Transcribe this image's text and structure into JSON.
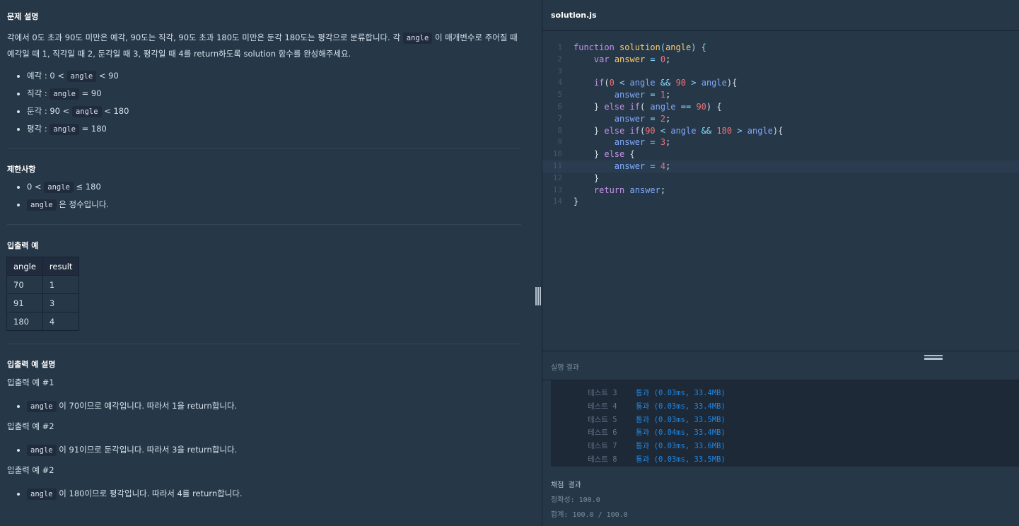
{
  "problem": {
    "title": "문제 설명",
    "desc_part1": "각에서 0도 초과 90도 미만은 예각, 90도는 직각, 90도 초과 180도 미만은 둔각 180도는 평각으로 분류합니다. 각",
    "desc_code": "angle",
    "desc_part2": "이 매개변수로 주어질 때",
    "desc_line2": "예각일 때 1, 직각일 때 2, 둔각일 때 3, 평각일 때 4를 return하도록 solution 함수를 완성해주세요.",
    "bullets": [
      {
        "label": "예각 : 0 <",
        "code": "angle",
        "after": "< 90"
      },
      {
        "label": "직각 :",
        "code": "angle",
        "after": "= 90"
      },
      {
        "label": "둔각 : 90 <",
        "code": "angle",
        "after": "< 180"
      },
      {
        "label": "평각 :",
        "code": "angle",
        "after": "= 180"
      }
    ]
  },
  "constraints": {
    "title": "제한사항",
    "item1_pre": "0 <",
    "item1_code": "angle",
    "item1_post": "≤ 180",
    "item2_code": "angle",
    "item2_post": "은 정수입니다."
  },
  "io_example": {
    "title": "입출력 예",
    "headers": [
      "angle",
      "result"
    ],
    "rows": [
      [
        "70",
        "1"
      ],
      [
        "91",
        "3"
      ],
      [
        "180",
        "4"
      ]
    ]
  },
  "io_explain": {
    "title": "입출력 예 설명",
    "ex1_title": "입출력 예 #1",
    "ex1_code": "angle",
    "ex1_text": "이 70이므로 예각입니다. 따라서 1을 return합니다.",
    "ex2_title": "입출력 예 #2",
    "ex2_code": "angle",
    "ex2_text": "이 91이므로 둔각입니다. 따라서 3을 return합니다.",
    "ex3_title": "입출력 예 #2",
    "ex3_code": "angle",
    "ex3_text": "이 180이므로 평각입니다. 따라서 4를 return합니다."
  },
  "editor": {
    "filename": "solution.js",
    "line_numbers": [
      "1",
      "2",
      "3",
      "4",
      "5",
      "6",
      "7",
      "8",
      "9",
      "10",
      "11",
      "12",
      "13",
      "14"
    ],
    "active_line": 11
  },
  "results_panel": {
    "title": "실행 결과",
    "rows": [
      {
        "label": "테스트 3",
        "value": "통과 (0.03ms, 33.4MB)"
      },
      {
        "label": "테스트 4",
        "value": "통과 (0.03ms, 33.4MB)"
      },
      {
        "label": "테스트 5",
        "value": "통과 (0.03ms, 33.5MB)"
      },
      {
        "label": "테스트 6",
        "value": "통과 (0.04ms, 33.4MB)"
      },
      {
        "label": "테스트 7",
        "value": "통과 (0.03ms, 33.6MB)"
      },
      {
        "label": "테스트 8",
        "value": "통과 (0.03ms, 33.5MB)"
      }
    ],
    "score_title": "채점 결과",
    "accuracy": "정확성: 100.0",
    "total": "합계: 100.0 / 100.0"
  },
  "colors": {
    "background": "#263747",
    "code_bg": "#202b3d",
    "pass": "#1e88e5"
  }
}
